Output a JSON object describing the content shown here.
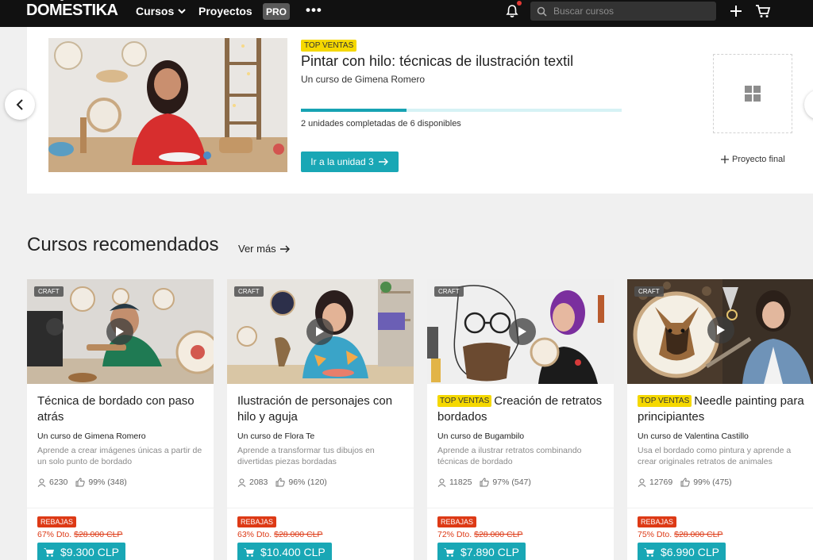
{
  "nav": {
    "logo": "DOMESTIKA",
    "courses": "Cursos",
    "projects": "Proyectos",
    "pro": "PRO",
    "more": "•••",
    "search_placeholder": "Buscar cursos"
  },
  "hero": {
    "badge": "TOP VENTAS",
    "title": "Pintar con hilo: técnicas de ilustración textil",
    "author": "Un curso de Gimena Romero",
    "progress_fraction": 0.33,
    "progress_text": "2 unidades completadas de 6 disponibles",
    "cta": "Ir a la unidad 3",
    "final_project": "Proyecto final"
  },
  "recommended": {
    "title": "Cursos recomendados",
    "more": "Ver más",
    "cards": [
      {
        "tag": "CRAFT",
        "badge": "",
        "title": "Técnica de bordado con paso atrás",
        "author": "Un curso de Gimena Romero",
        "desc": "Aprende a crear imágenes únicas a partir de un solo punto de bordado",
        "students": "6230",
        "rating": "99% (348)",
        "sale": "REBAJAS",
        "discount": "67% Dto.",
        "old_price": "$28.000 CLP",
        "price": "$9.300 CLP"
      },
      {
        "tag": "CRAFT",
        "badge": "",
        "title": "Ilustración de personajes con hilo y aguja",
        "author": "Un curso de Flora Te",
        "desc": "Aprende a transformar tus dibujos en divertidas piezas bordadas",
        "students": "2083",
        "rating": "96% (120)",
        "sale": "REBAJAS",
        "discount": "63% Dto.",
        "old_price": "$28.000 CLP",
        "price": "$10.400 CLP"
      },
      {
        "tag": "CRAFT",
        "badge": "TOP VENTAS",
        "title": "Creación de retratos bordados",
        "author": "Un curso de Bugambilo",
        "desc": "Aprende a ilustrar retratos combinando técnicas de bordado",
        "students": "11825",
        "rating": "97% (547)",
        "sale": "REBAJAS",
        "discount": "72% Dto.",
        "old_price": "$28.000 CLP",
        "price": "$7.890 CLP"
      },
      {
        "tag": "CRAFT",
        "badge": "TOP VENTAS",
        "title": "Needle painting para principiantes",
        "author": "Un curso de Valentina Castillo",
        "desc": "Usa el bordado como pintura y aprende a crear originales retratos de animales",
        "students": "12769",
        "rating": "99% (475)",
        "sale": "REBAJAS",
        "discount": "75% Dto.",
        "old_price": "$28.000 CLP",
        "price": "$6.990 CLP"
      }
    ]
  },
  "colors": {
    "nav_bg": "#111111",
    "accent": "#19a7b5",
    "top_badge": "#f5d800",
    "sale": "#dd3a16"
  }
}
